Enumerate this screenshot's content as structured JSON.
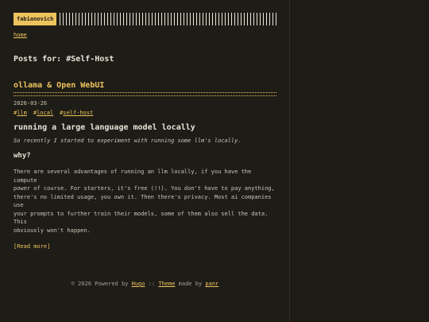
{
  "header": {
    "logo": "fabianovich"
  },
  "nav": {
    "home": "home"
  },
  "list": {
    "title": "Posts for: #Self-Host"
  },
  "post": {
    "title": "ollama & Open WebUI",
    "date": "2026-03-26",
    "tags": [
      "llm",
      "local",
      "self-host"
    ],
    "heading": "running a large language model locally",
    "intro": "So recently I started to experiment with running some llm's locally.",
    "subheading": "why?",
    "body_lines": [
      "There are several advantages of running an llm locally, if you have the compute",
      "power of course. For starters, it's free (!!). You don't have to pay anything,",
      "there's no limited usage, you own it. Then there's privacy. Most ai companies use",
      "your prompts to further train their models, some of them also sell the data. This",
      "obviously won't happen."
    ],
    "read_more": "[Read more]"
  },
  "footer": {
    "copyright": "© 2026 Powered by",
    "hugo": "Hugo",
    "sep": "::",
    "theme": "Theme",
    "made_by": "made by",
    "author": "panr"
  },
  "colors": {
    "background": "#1e1c16",
    "accent": "#eec35e",
    "text": "#e8e4d8"
  }
}
